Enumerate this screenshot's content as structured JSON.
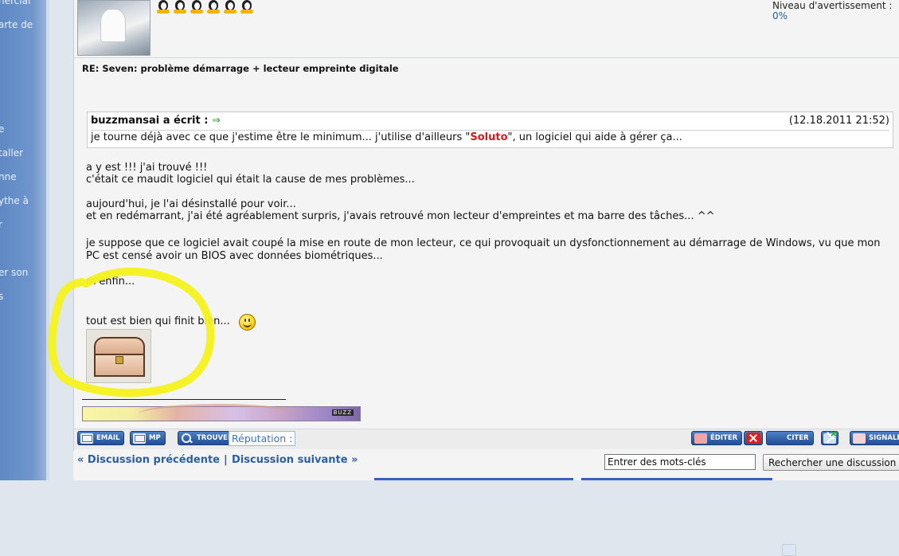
{
  "sidebar": {
    "items": [
      "nercial",
      "arte de",
      "e",
      "taller",
      "nne",
      "ythe à",
      "r",
      "er son",
      "s"
    ]
  },
  "profile": {
    "rank_icon_count": 6,
    "warning_label": "Niveau d'avertissement :",
    "warning_value": "0%"
  },
  "post": {
    "title": "RE: Seven: problème démarrage + lecteur empreinte digitale",
    "quote": {
      "author": "buzzmansai a écrit :",
      "arrow": "⇒",
      "date": "(12.18.2011 21:52)",
      "text_before": "je tourne déjà avec ce que j'estime être le minimum... j'utilise d'ailleurs \"",
      "highlight": "Soluto",
      "text_after": "\", un logiciel qui aide à gérer ça..."
    },
    "lines": [
      "a y est !!! j'ai trouvé !!!",
      "c'était ce maudit logiciel qui était la cause de mes problèmes...",
      "aujourd'hui, je l'ai désinstallé pour voir...",
      "et en redémarrant, j'ai été agréablement surpris, j'avais retrouvé mon lecteur d'empreintes et ma barre des tâches... ^^",
      "je suppose que ce logiciel avait coupé la mise en route de mon lecteur, ce qui provoquait un dysfonctionnement au démarrage de Windows, vu que mon",
      "PC est censé avoir un BIOS avec données biométriques...",
      "m'enfin...",
      "tout est bien qui finit bien..."
    ],
    "signature_tag": "BUZZ"
  },
  "actions": {
    "email": "EMAIL",
    "mp": "MP",
    "trouver": "TROUVER",
    "reputation": "Réputation :",
    "editer": "ÉDITER",
    "citer": "CITER",
    "signaler": "SIGNALER"
  },
  "nav": {
    "prev": "« Discussion précédente",
    "separator": "|",
    "next": "Discussion suivante »",
    "search_placeholder": "Entrer des mots-clés",
    "search_button": "Rechercher une discussion"
  },
  "colors": {
    "accent_link": "#2a5ea8",
    "highlight_marker": "#f4f21c",
    "quote_highlight": "#d81a1a",
    "button_blue": "#1f4f98"
  }
}
